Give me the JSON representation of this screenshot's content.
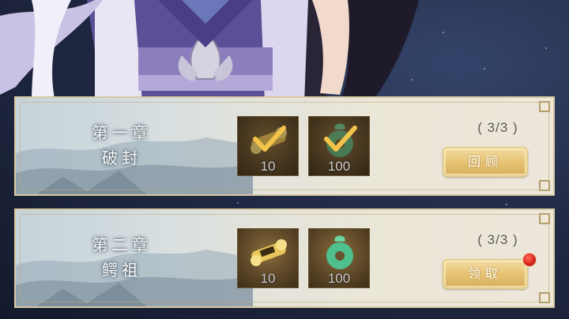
{
  "chapters": [
    {
      "title": "第一章",
      "subtitle": "破封",
      "rewards": [
        {
          "item": "golden-scroll-icon",
          "count": "10",
          "claimed": true
        },
        {
          "item": "jade-pendant-icon",
          "count": "100",
          "claimed": true
        }
      ],
      "progress": "( 3/3 )",
      "button_label": "回顾",
      "has_notification": false
    },
    {
      "title": "第二章",
      "subtitle": "鳄祖",
      "rewards": [
        {
          "item": "golden-scroll-icon",
          "count": "10",
          "claimed": false
        },
        {
          "item": "jade-pendant-icon",
          "count": "100",
          "claimed": false
        }
      ],
      "progress": "( 3/3 )",
      "button_label": "领取",
      "has_notification": true
    }
  ],
  "colors": {
    "card_border": "#d8c9a2",
    "button_gold": "#e5c171",
    "check_gold": "#f3c44a",
    "notification_red": "#d8271d"
  }
}
